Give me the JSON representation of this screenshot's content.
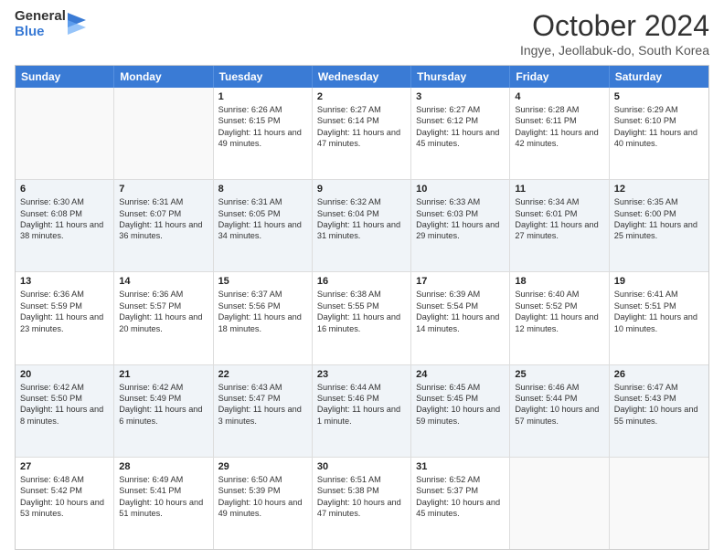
{
  "logo": {
    "general": "General",
    "blue": "Blue"
  },
  "header": {
    "month": "October 2024",
    "location": "Ingye, Jeollabuk-do, South Korea"
  },
  "days": [
    "Sunday",
    "Monday",
    "Tuesday",
    "Wednesday",
    "Thursday",
    "Friday",
    "Saturday"
  ],
  "weeks": [
    [
      {
        "day": "",
        "info": ""
      },
      {
        "day": "",
        "info": ""
      },
      {
        "day": "1",
        "info": "Sunrise: 6:26 AM\nSunset: 6:15 PM\nDaylight: 11 hours and 49 minutes."
      },
      {
        "day": "2",
        "info": "Sunrise: 6:27 AM\nSunset: 6:14 PM\nDaylight: 11 hours and 47 minutes."
      },
      {
        "day": "3",
        "info": "Sunrise: 6:27 AM\nSunset: 6:12 PM\nDaylight: 11 hours and 45 minutes."
      },
      {
        "day": "4",
        "info": "Sunrise: 6:28 AM\nSunset: 6:11 PM\nDaylight: 11 hours and 42 minutes."
      },
      {
        "day": "5",
        "info": "Sunrise: 6:29 AM\nSunset: 6:10 PM\nDaylight: 11 hours and 40 minutes."
      }
    ],
    [
      {
        "day": "6",
        "info": "Sunrise: 6:30 AM\nSunset: 6:08 PM\nDaylight: 11 hours and 38 minutes."
      },
      {
        "day": "7",
        "info": "Sunrise: 6:31 AM\nSunset: 6:07 PM\nDaylight: 11 hours and 36 minutes."
      },
      {
        "day": "8",
        "info": "Sunrise: 6:31 AM\nSunset: 6:05 PM\nDaylight: 11 hours and 34 minutes."
      },
      {
        "day": "9",
        "info": "Sunrise: 6:32 AM\nSunset: 6:04 PM\nDaylight: 11 hours and 31 minutes."
      },
      {
        "day": "10",
        "info": "Sunrise: 6:33 AM\nSunset: 6:03 PM\nDaylight: 11 hours and 29 minutes."
      },
      {
        "day": "11",
        "info": "Sunrise: 6:34 AM\nSunset: 6:01 PM\nDaylight: 11 hours and 27 minutes."
      },
      {
        "day": "12",
        "info": "Sunrise: 6:35 AM\nSunset: 6:00 PM\nDaylight: 11 hours and 25 minutes."
      }
    ],
    [
      {
        "day": "13",
        "info": "Sunrise: 6:36 AM\nSunset: 5:59 PM\nDaylight: 11 hours and 23 minutes."
      },
      {
        "day": "14",
        "info": "Sunrise: 6:36 AM\nSunset: 5:57 PM\nDaylight: 11 hours and 20 minutes."
      },
      {
        "day": "15",
        "info": "Sunrise: 6:37 AM\nSunset: 5:56 PM\nDaylight: 11 hours and 18 minutes."
      },
      {
        "day": "16",
        "info": "Sunrise: 6:38 AM\nSunset: 5:55 PM\nDaylight: 11 hours and 16 minutes."
      },
      {
        "day": "17",
        "info": "Sunrise: 6:39 AM\nSunset: 5:54 PM\nDaylight: 11 hours and 14 minutes."
      },
      {
        "day": "18",
        "info": "Sunrise: 6:40 AM\nSunset: 5:52 PM\nDaylight: 11 hours and 12 minutes."
      },
      {
        "day": "19",
        "info": "Sunrise: 6:41 AM\nSunset: 5:51 PM\nDaylight: 11 hours and 10 minutes."
      }
    ],
    [
      {
        "day": "20",
        "info": "Sunrise: 6:42 AM\nSunset: 5:50 PM\nDaylight: 11 hours and 8 minutes."
      },
      {
        "day": "21",
        "info": "Sunrise: 6:42 AM\nSunset: 5:49 PM\nDaylight: 11 hours and 6 minutes."
      },
      {
        "day": "22",
        "info": "Sunrise: 6:43 AM\nSunset: 5:47 PM\nDaylight: 11 hours and 3 minutes."
      },
      {
        "day": "23",
        "info": "Sunrise: 6:44 AM\nSunset: 5:46 PM\nDaylight: 11 hours and 1 minute."
      },
      {
        "day": "24",
        "info": "Sunrise: 6:45 AM\nSunset: 5:45 PM\nDaylight: 10 hours and 59 minutes."
      },
      {
        "day": "25",
        "info": "Sunrise: 6:46 AM\nSunset: 5:44 PM\nDaylight: 10 hours and 57 minutes."
      },
      {
        "day": "26",
        "info": "Sunrise: 6:47 AM\nSunset: 5:43 PM\nDaylight: 10 hours and 55 minutes."
      }
    ],
    [
      {
        "day": "27",
        "info": "Sunrise: 6:48 AM\nSunset: 5:42 PM\nDaylight: 10 hours and 53 minutes."
      },
      {
        "day": "28",
        "info": "Sunrise: 6:49 AM\nSunset: 5:41 PM\nDaylight: 10 hours and 51 minutes."
      },
      {
        "day": "29",
        "info": "Sunrise: 6:50 AM\nSunset: 5:39 PM\nDaylight: 10 hours and 49 minutes."
      },
      {
        "day": "30",
        "info": "Sunrise: 6:51 AM\nSunset: 5:38 PM\nDaylight: 10 hours and 47 minutes."
      },
      {
        "day": "31",
        "info": "Sunrise: 6:52 AM\nSunset: 5:37 PM\nDaylight: 10 hours and 45 minutes."
      },
      {
        "day": "",
        "info": ""
      },
      {
        "day": "",
        "info": ""
      }
    ]
  ]
}
